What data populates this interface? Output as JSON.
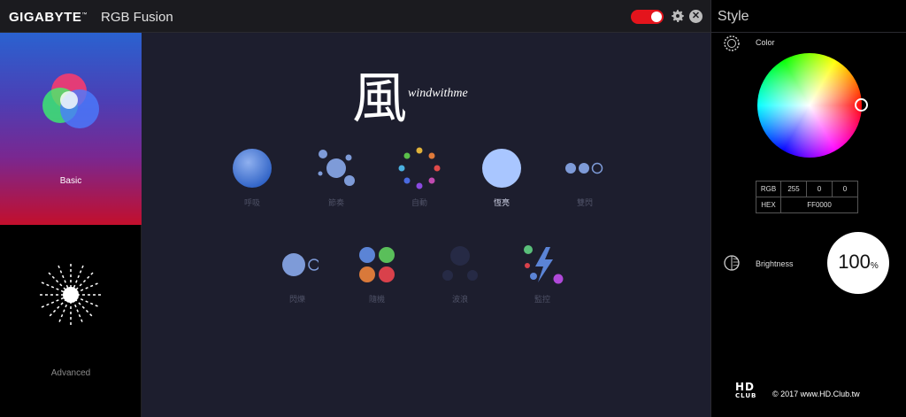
{
  "titlebar": {
    "brand": "GIGABYTE",
    "trademark": "™",
    "app_title": "RGB Fusion"
  },
  "nav": {
    "basic_label": "Basic",
    "advanced_label": "Advanced"
  },
  "main": {
    "logo_glyph": "風",
    "logo_text": "windwithme",
    "modes_row1": [
      {
        "label": "呼吸"
      },
      {
        "label": "節奏"
      },
      {
        "label": "自動"
      },
      {
        "label": "恆亮",
        "active": true
      },
      {
        "label": "雙閃"
      }
    ],
    "modes_row2": [
      {
        "label": "閃爍"
      },
      {
        "label": "隨機"
      },
      {
        "label": "波浪"
      },
      {
        "label": "監控"
      }
    ]
  },
  "style": {
    "title": "Style",
    "color_label": "Color",
    "rgb": {
      "label": "RGB",
      "r": "255",
      "g": "0",
      "b": "0"
    },
    "hex": {
      "label": "HEX",
      "value": "FF0000"
    },
    "brightness_label": "Brightness",
    "brightness_value": "100",
    "brightness_unit": "%"
  },
  "watermark": {
    "logo_line1": "HD",
    "logo_line2": "CLUB",
    "text": "© 2017 www.HD.Club.tw"
  },
  "colors": {
    "accent_red": "#e4141c",
    "main_bg": "#1d1e2e",
    "mode_blue": "#5b84d6"
  }
}
